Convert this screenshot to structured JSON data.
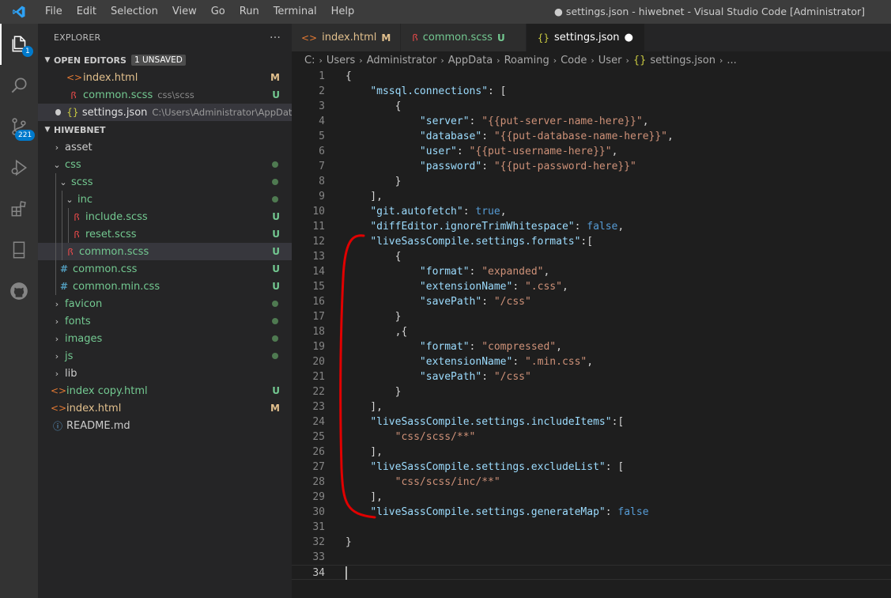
{
  "titlebar": {
    "menu": [
      "File",
      "Edit",
      "Selection",
      "View",
      "Go",
      "Run",
      "Terminal",
      "Help"
    ],
    "window_title": "● settings.json - hiwebnet - Visual Studio Code [Administrator]"
  },
  "activity": {
    "explorer_badge": "1",
    "scm_badge": "221",
    "icons": [
      "files-icon",
      "search-icon",
      "source-control-icon",
      "run-debug-icon",
      "extensions-icon",
      "remote-explorer-icon",
      "github-icon"
    ]
  },
  "sidebar": {
    "title": "EXPLORER",
    "more": "···",
    "open_editors": {
      "label": "OPEN EDITORS",
      "badge": "1 UNSAVED",
      "items": [
        {
          "name": "index.html",
          "detail": "",
          "status": "M"
        },
        {
          "name": "common.scss",
          "detail": "css\\scss",
          "status": "U"
        },
        {
          "name": "settings.json",
          "detail": "C:\\Users\\Administrator\\AppData\\R...",
          "status": ""
        }
      ]
    },
    "workspace": {
      "label": "HIWEBNET",
      "tree": [
        {
          "name": "asset"
        },
        {
          "name": "css"
        },
        {
          "name": "scss"
        },
        {
          "name": "inc"
        },
        {
          "name": "include.scss",
          "status": "U"
        },
        {
          "name": "reset.scss",
          "status": "U"
        },
        {
          "name": "common.scss",
          "status": "U"
        },
        {
          "name": "common.css",
          "status": "U"
        },
        {
          "name": "common.min.css",
          "status": "U"
        },
        {
          "name": "favicon"
        },
        {
          "name": "fonts"
        },
        {
          "name": "images"
        },
        {
          "name": "js"
        },
        {
          "name": "lib"
        },
        {
          "name": "index copy.html",
          "status": "U"
        },
        {
          "name": "index.html",
          "status": "M"
        },
        {
          "name": "README.md"
        }
      ]
    }
  },
  "tabs": [
    {
      "label": "index.html",
      "mark": "M"
    },
    {
      "label": "common.scss",
      "mark": "U"
    },
    {
      "label": "settings.json",
      "mark": "●"
    }
  ],
  "breadcrumb": [
    "C:",
    "Users",
    "Administrator",
    "AppData",
    "Roaming",
    "Code",
    "User",
    "settings.json",
    "..."
  ],
  "code": {
    "line_numbers": [
      "1",
      "2",
      "3",
      "4",
      "5",
      "6",
      "7",
      "8",
      "9",
      "10",
      "11",
      "12",
      "13",
      "14",
      "15",
      "16",
      "17",
      "18",
      "19",
      "20",
      "21",
      "22",
      "23",
      "24",
      "25",
      "26",
      "27",
      "28",
      "29",
      "30",
      "31",
      "32",
      "33",
      "34"
    ],
    "lines": [
      "{",
      "    \"mssql.connections\": [",
      "        {",
      "            \"server\": \"{{put-server-name-here}}\",",
      "            \"database\": \"{{put-database-name-here}}\",",
      "            \"user\": \"{{put-username-here}}\",",
      "            \"password\": \"{{put-password-here}}\"",
      "        }",
      "    ],",
      "    \"git.autofetch\": true,",
      "    \"diffEditor.ignoreTrimWhitespace\": false,",
      "    \"liveSassCompile.settings.formats\":[",
      "        {",
      "            \"format\": \"expanded\",",
      "            \"extensionName\": \".css\",",
      "            \"savePath\": \"/css\"",
      "        }",
      "        ,{",
      "            \"format\": \"compressed\",",
      "            \"extensionName\": \".min.css\",",
      "            \"savePath\": \"/css\"",
      "        }",
      "    ],",
      "    \"liveSassCompile.settings.includeItems\":[",
      "        \"css/scss/**\"",
      "    ],",
      "    \"liveSassCompile.settings.excludeList\": [",
      "        \"css/scss/inc/**\"",
      "    ],",
      "    \"liveSassCompile.settings.generateMap\": false",
      "",
      "}",
      "",
      ""
    ]
  },
  "colors": {
    "accent": "#007acc",
    "modified": "#e2c08d",
    "untracked": "#73c991",
    "annotation": "#e00000"
  }
}
